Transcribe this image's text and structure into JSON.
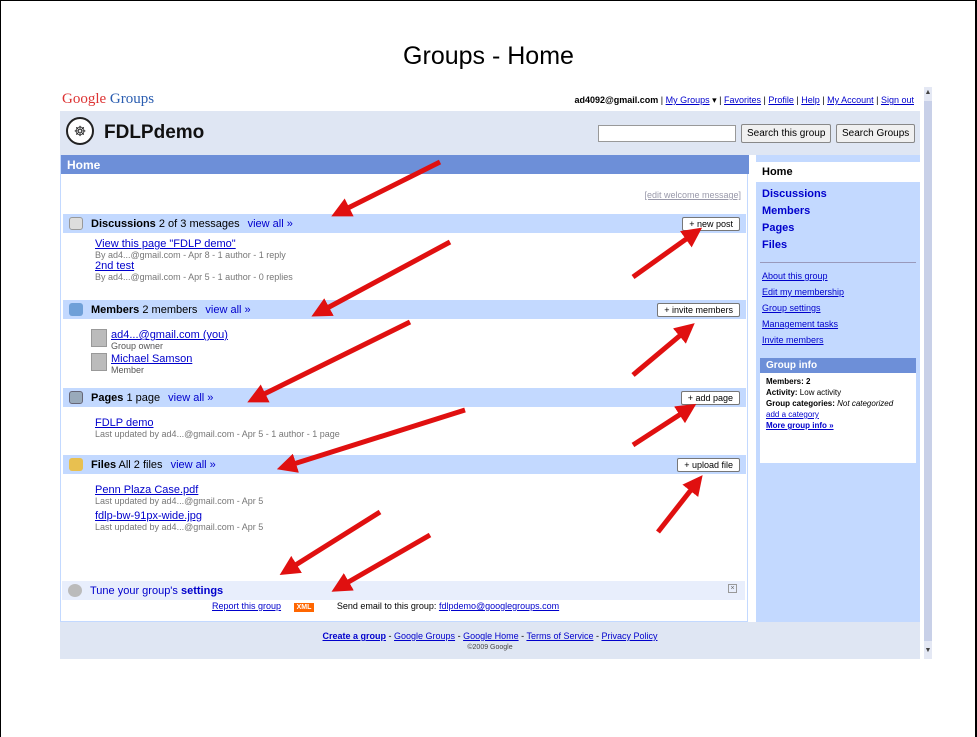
{
  "slide_title": "Groups - Home",
  "brand": {
    "google": "Google",
    "groups": "Groups"
  },
  "user_links": {
    "email": "ad4092@gmail.com",
    "my_groups": "My Groups",
    "favorites": "Favorites",
    "profile": "Profile",
    "help": "Help",
    "my_account": "My Account",
    "sign_out": "Sign out"
  },
  "group": {
    "name": "FDLPdemo"
  },
  "search": {
    "this_group_label": "Search this group",
    "groups_label": "Search Groups"
  },
  "home_bar": "Home",
  "edit_welcome": "[edit welcome message]",
  "discussions": {
    "title": "Discussions",
    "count": "2 of 3 messages",
    "view_all": "view all »",
    "button": "+ new post",
    "items": [
      {
        "title": "View this page \"FDLP demo\"",
        "meta": "By ad4...@gmail.com - Apr 8 - 1 author - 1 reply"
      },
      {
        "title": "2nd test",
        "meta": "By ad4...@gmail.com - Apr 5 - 1 author - 0 replies"
      }
    ]
  },
  "members": {
    "title": "Members",
    "count": "2 members",
    "view_all": "view all »",
    "button": "+ invite members",
    "items": [
      {
        "name": "ad4...@gmail.com (you)",
        "role": "Group owner"
      },
      {
        "name": "Michael Samson",
        "role": "Member"
      }
    ]
  },
  "pages": {
    "title": "Pages",
    "count": "1 page",
    "view_all": "view all »",
    "button": "+ add page",
    "items": [
      {
        "title": "FDLP demo",
        "meta": "Last updated by ad4...@gmail.com - Apr 5 - 1 author - 1 page"
      }
    ]
  },
  "files": {
    "title": "Files",
    "count": "All 2 files",
    "view_all": "view all »",
    "button": "+ upload file",
    "items": [
      {
        "title": "Penn Plaza Case.pdf",
        "meta": "Last updated by ad4...@gmail.com - Apr 5"
      },
      {
        "title": "fdlp-bw-91px-wide.jpg",
        "meta": "Last updated by ad4...@gmail.com - Apr 5"
      }
    ]
  },
  "tune": {
    "prefix": "Tune your group's",
    "bold": "settings"
  },
  "report": {
    "link": "Report this group",
    "xml": "XML",
    "email_text": "Send email to this group:",
    "email": "fdlpdemo@googlegroups.com"
  },
  "footer": {
    "create": "Create a group",
    "google_groups": "Google Groups",
    "google_home": "Google Home",
    "terms": "Terms of Service",
    "privacy": "Privacy Policy",
    "copyright": "©2009 Google"
  },
  "sidebar": {
    "home": "Home",
    "nav": [
      "Discussions",
      "Members",
      "Pages",
      "Files"
    ],
    "links": [
      "About this group",
      "Edit my membership",
      "Group settings",
      "Management tasks",
      "Invite members"
    ],
    "info": {
      "header": "Group info",
      "members_label": "Members:",
      "members_value": "2",
      "activity_label": "Activity:",
      "activity_value": "Low activity",
      "categories_label": "Group categories:",
      "categories_value": "Not categorized",
      "add_category": "add a category",
      "more_info": "More group info »"
    }
  },
  "colors": {
    "arrow": "#e01010",
    "section_bar": "#c3d9ff",
    "home_bar": "#6d8fd8"
  }
}
